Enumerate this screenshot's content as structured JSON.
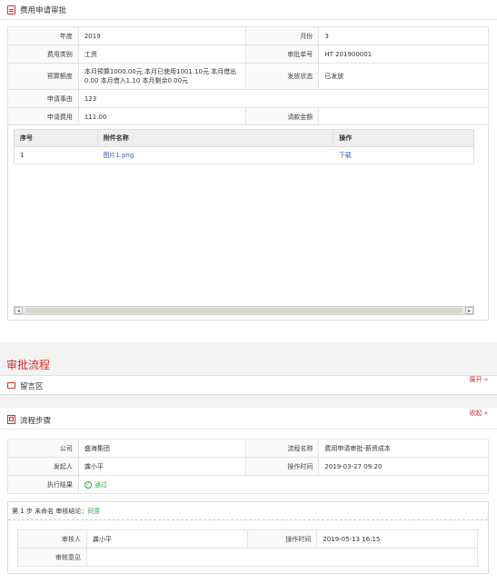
{
  "approval_panel": {
    "title": "费用申请审批",
    "form": {
      "year_label": "年度",
      "year_value": "2019",
      "month_label": "月份",
      "month_value": "3",
      "category_label": "费用类别",
      "category_value": "工资",
      "approval_no_label": "审批单号",
      "approval_no_value": "HT 201900001",
      "budget_label": "预算额度",
      "budget_value_line1": "本月预算1000.00元 本月已使用1001.10元 本月借出",
      "budget_value_line2": "0.00 本月借入1.10 本月剩余0.00元",
      "status_label": "发放状态",
      "status_value": "已发放",
      "reason_label": "申请事由",
      "reason_value": "123",
      "amount_label": "申请费用",
      "amount_value": "111.00",
      "request_amount_label": "请款金额",
      "request_amount_value": ""
    },
    "attachments": {
      "columns": [
        "序号",
        "附件名称",
        "操作"
      ],
      "rows": [
        {
          "no": "1",
          "name": "图片1.png",
          "action": "下载"
        }
      ]
    }
  },
  "approval_flow": {
    "heading": "审批流程",
    "comments": {
      "label": "留言区",
      "toggle": "展开"
    },
    "steps_section": {
      "label": "流程步骤",
      "toggle": "收起",
      "company_label": "公司",
      "company_value": "盛海集团",
      "flow_name_label": "流程名称",
      "flow_name_value": "费用申请审批-薪资成本",
      "initiator_label": "发起人",
      "initiator_value": "龚小平",
      "op_time_label": "操作时间",
      "op_time_value": "2019-03-27 09:20",
      "result_label": "执行结果",
      "result_value": "通过",
      "step": {
        "head_prefix": "第 1 步 未命名  审核结论：",
        "head_result": "同意",
        "reviewer_label": "审核人",
        "reviewer_value": "龚小平",
        "time_label": "操作时间",
        "time_value": "2019-05-13 16:15",
        "opinion_label": "审核意见",
        "opinion_value": ""
      }
    }
  },
  "colors": {
    "accent": "#c9302c",
    "success": "#3aa34a",
    "link": "#2f62b7"
  }
}
